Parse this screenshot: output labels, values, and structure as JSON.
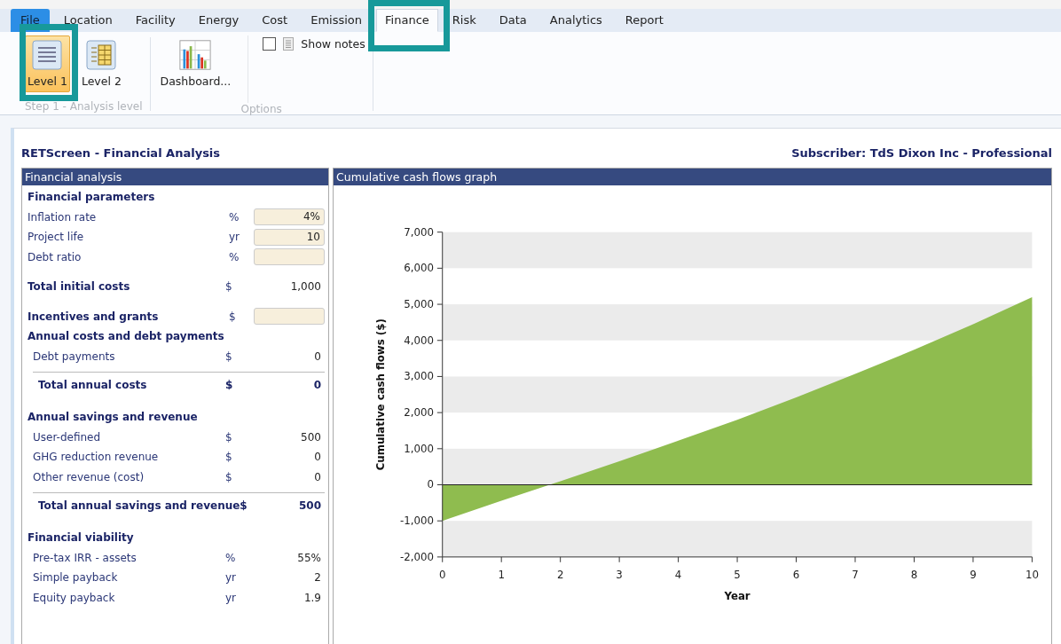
{
  "tabs": [
    {
      "label": "File",
      "selected": false,
      "kind": "file"
    },
    {
      "label": "Location",
      "selected": false,
      "kind": "tab"
    },
    {
      "label": "Facility",
      "selected": false,
      "kind": "tab"
    },
    {
      "label": "Energy",
      "selected": false,
      "kind": "tab"
    },
    {
      "label": "Cost",
      "selected": false,
      "kind": "tab"
    },
    {
      "label": "Emission",
      "selected": false,
      "kind": "tab"
    },
    {
      "label": "Finance",
      "selected": true,
      "kind": "tab"
    },
    {
      "label": "Risk",
      "selected": false,
      "kind": "tab"
    },
    {
      "label": "Data",
      "selected": false,
      "kind": "tab"
    },
    {
      "label": "Analytics",
      "selected": false,
      "kind": "tab"
    },
    {
      "label": "Report",
      "selected": false,
      "kind": "tab"
    }
  ],
  "ribbon": {
    "analysis_level": {
      "label": "Step 1 - Analysis level",
      "buttons": [
        {
          "label": "Level 1",
          "selected": true
        },
        {
          "label": "Level 2",
          "selected": false
        }
      ]
    },
    "options": {
      "label": "Options",
      "dashboard": "Dashboard...",
      "show_notes": {
        "label": "Show notes",
        "checked": false
      }
    }
  },
  "header": {
    "title": "RETScreen - Financial Analysis",
    "subscriber": "Subscriber: TdS Dixon Inc - Professional"
  },
  "financial_analysis": {
    "title": "Financial analysis",
    "groups": [
      [
        {
          "kind": "section",
          "label": "Financial parameters"
        },
        {
          "kind": "input",
          "label": "Inflation rate",
          "unit": "%",
          "value": "4%"
        },
        {
          "kind": "input",
          "label": "Project life",
          "unit": "yr",
          "value": "10"
        },
        {
          "kind": "input",
          "label": "Debt ratio",
          "unit": "%"
        }
      ],
      [
        {
          "kind": "output",
          "label": "Total initial costs",
          "unit": "$",
          "value": "1,000",
          "bold": true
        }
      ],
      [
        {
          "kind": "input",
          "label": "Incentives and grants",
          "unit": "$",
          "bold": true
        },
        {
          "kind": "section",
          "label": "Annual costs and debt payments"
        },
        {
          "kind": "output",
          "label": "Debt payments",
          "unit": "$",
          "value": "0",
          "indent": true
        },
        {
          "kind": "total",
          "label": "Total annual costs",
          "unit": "$",
          "value": "0"
        }
      ],
      [
        {
          "kind": "section",
          "label": "Annual savings and revenue"
        },
        {
          "kind": "output",
          "label": "User-defined",
          "unit": "$",
          "value": "500",
          "indent": true
        },
        {
          "kind": "output",
          "label": "GHG reduction revenue",
          "unit": "$",
          "value": "0",
          "indent": true
        },
        {
          "kind": "output",
          "label": "Other revenue (cost)",
          "unit": "$",
          "value": "0",
          "indent": true
        },
        {
          "kind": "total",
          "label": "Total annual savings and revenue",
          "unit": "$",
          "value": "500"
        }
      ],
      [
        {
          "kind": "section",
          "label": "Financial viability"
        },
        {
          "kind": "output",
          "label": "Pre-tax IRR - assets",
          "unit": "%",
          "value": "55%",
          "indent": true
        },
        {
          "kind": "output",
          "label": "Simple payback",
          "unit": "yr",
          "value": "2",
          "indent": true
        },
        {
          "kind": "output",
          "label": "Equity payback",
          "unit": "yr",
          "value": "1.9",
          "indent": true
        }
      ]
    ]
  },
  "cash_flow_graph": {
    "title": "Cumulative cash flows graph",
    "chart_data": {
      "type": "area",
      "xlabel": "Year",
      "ylabel": "Cumulative cash flows ($)",
      "x": [
        0,
        1,
        2,
        3,
        4,
        5,
        6,
        7,
        8,
        9,
        10
      ],
      "series": [
        {
          "color": "#8fbc4f",
          "values": [
            -1000,
            -440,
            100,
            650,
            1220,
            1800,
            2420,
            3070,
            3740,
            4450,
            5200
          ]
        }
      ],
      "xlim": [
        0,
        10
      ],
      "ylim": [
        -2000,
        7000
      ],
      "xticks": [
        0,
        1,
        2,
        3,
        4,
        5,
        6,
        7,
        8,
        9,
        10
      ],
      "yticks": [
        {
          "value": -2000,
          "label": "-2,000"
        },
        {
          "value": -1000,
          "label": "-1,000"
        },
        {
          "value": 0,
          "label": "0"
        },
        {
          "value": 1000,
          "label": "1,000"
        },
        {
          "value": 2000,
          "label": "2,000"
        },
        {
          "value": 3000,
          "label": "3,000"
        },
        {
          "value": 4000,
          "label": "4,000"
        },
        {
          "value": 5000,
          "label": "5,000"
        },
        {
          "value": 6000,
          "label": "6,000"
        },
        {
          "value": 7000,
          "label": "7,000"
        }
      ]
    }
  }
}
